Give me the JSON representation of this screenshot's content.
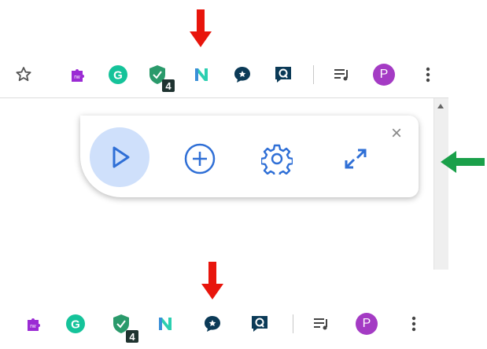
{
  "annotations": {
    "top_arrow": "red-down-arrow",
    "right_arrow": "green-left-arrow",
    "bottom_arrow": "red-down-arrow"
  },
  "toolbar_top": {
    "badge_count": "4",
    "profile_initial": "P",
    "icons": [
      "star-icon",
      "rw-puzzle-icon",
      "grammarly-icon",
      "shield-check-icon",
      "n-logo-icon",
      "chat-star-icon",
      "chat-square-icon",
      "media-playlist-icon",
      "profile-avatar",
      "more-vert-icon"
    ]
  },
  "panel": {
    "close_label": "×",
    "buttons": [
      "play-icon",
      "add-circle-icon",
      "settings-gear-icon",
      "expand-icon"
    ]
  },
  "toolbar_bottom": {
    "badge_count": "4",
    "profile_initial": "P",
    "icons": [
      "rw-puzzle-icon",
      "grammarly-icon",
      "shield-check-icon",
      "n-logo-icon",
      "chat-star-icon",
      "chat-square-icon",
      "media-playlist-icon",
      "profile-avatar",
      "more-vert-icon"
    ]
  },
  "colors": {
    "red_arrow": "#e8150c",
    "green_arrow": "#1aa04a",
    "accent_blue": "#2f6fd6",
    "play_bg": "#cfe0fb",
    "avatar": "#a43bc4",
    "grammarly": "#15c39a",
    "shield": "#2a9a6b",
    "chat_navy": "#0b3a57"
  }
}
